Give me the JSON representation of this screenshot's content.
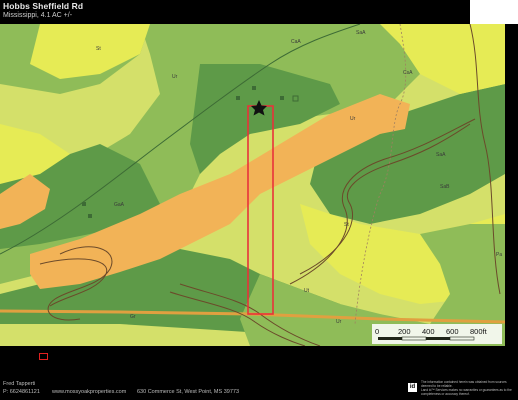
{
  "header": {
    "title": "Hobbs Sheffield Rd",
    "subtitle": "Mississippi, 4.1 AC +/-"
  },
  "map": {
    "soil_labels": [
      "St",
      "Ur",
      "CaA",
      "SaA",
      "CsA",
      "Ur",
      "SaA",
      "GaA",
      "St",
      "Pa",
      "Ut",
      "Ur",
      "Gr",
      "SaB"
    ],
    "marker_icon": "star-icon",
    "boundary_color": "#e8333a",
    "colors": {
      "light_green": "#d4e06a",
      "yellow": "#e6eb55",
      "mid_green": "#8fbc58",
      "dark_green": "#5e9a48",
      "orange": "#f2b357",
      "road": "#e0a040"
    }
  },
  "scale": {
    "labels": [
      "0",
      "200",
      "400",
      "600",
      "800ft"
    ]
  },
  "footer": {
    "agent_name": "Fred Tapperti",
    "agent_phone": "P: 6624861121",
    "website": "www.mossyoakproperties.com",
    "address": "630 Commerce St, West Point, MS 39773",
    "logo_text": "id",
    "disclaimer_1": "The information contained herein was obtained from sources",
    "disclaimer_2": "deemed to be reliable.",
    "disclaimer_3": "Land id™ Services makes no warranties or guarantees as to the",
    "disclaimer_4": "completeness or accuracy thereof."
  }
}
